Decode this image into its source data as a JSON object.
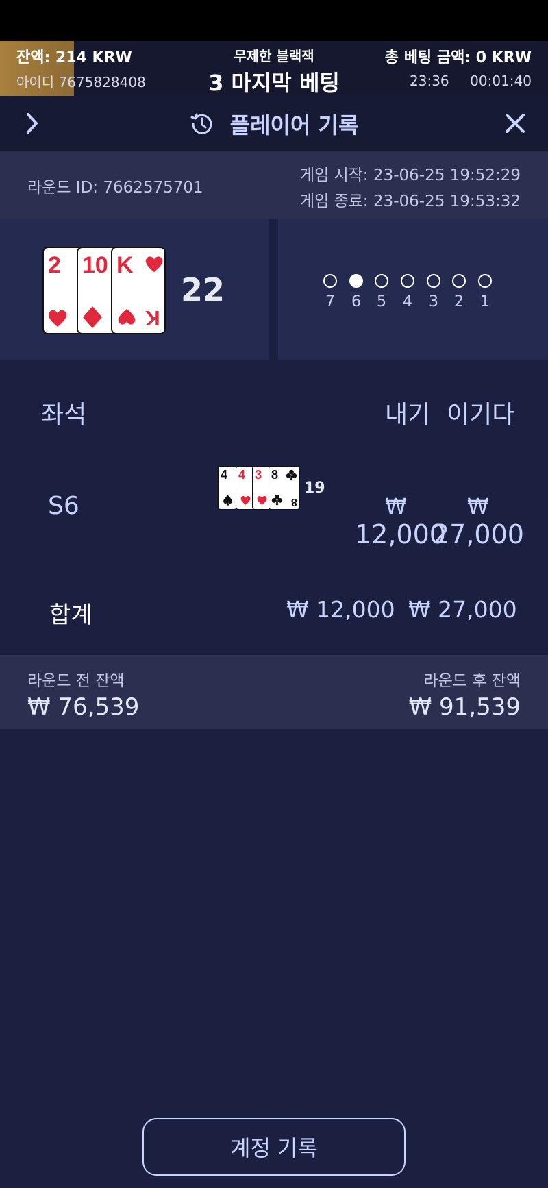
{
  "topbar": {
    "balance": "잔액: 214 KRW",
    "user_id": "아이디 7675828408",
    "game_name": "무제한 블랙잭",
    "phase": "3 마지막 베팅",
    "total_bet": "총 베팅 금액: 0 KRW",
    "clock": "23:36",
    "timer": "00:01:40"
  },
  "header": {
    "title": "플레이어 기록",
    "back_icon": "chevron-right-icon",
    "history_icon": "history-icon",
    "close_icon": "close-icon"
  },
  "round": {
    "round_id": "라운드 ID: 7662575701",
    "start": "게임 시작: 23-06-25 19:52:29",
    "end": "게임 종료: 23-06-25 19:53:32"
  },
  "dealer": {
    "cards": [
      {
        "rank": "2",
        "suit": "heart"
      },
      {
        "rank": "10",
        "suit": "diamond"
      },
      {
        "rank": "K",
        "suit": "heart"
      }
    ],
    "score": "22"
  },
  "seats": {
    "numbers": [
      "7",
      "6",
      "5",
      "4",
      "3",
      "2",
      "1"
    ],
    "active_seat": "6"
  },
  "table_headers": {
    "seat": "좌석",
    "bet": "내기",
    "win": "이기다"
  },
  "seat_row": {
    "seat": "S6",
    "cards": [
      {
        "rank": "4",
        "suit": "spade"
      },
      {
        "rank": "4",
        "suit": "heart"
      },
      {
        "rank": "3",
        "suit": "heart"
      },
      {
        "rank": "8",
        "suit": "club"
      }
    ],
    "score": "19",
    "currency": "₩",
    "bet": "12,000",
    "win": "27,000"
  },
  "totals": {
    "label": "합계",
    "bet": "₩ 12,000",
    "win": "₩ 27,000"
  },
  "balances": {
    "before_label": "라운드 전 잔액",
    "before_value": "₩ 76,539",
    "after_label": "라운드 후 잔액",
    "after_value": "₩ 91,539"
  },
  "account_button": "계정 기록",
  "colors": {
    "background": "#1c2040",
    "panel": "#252b50",
    "accent_text": "#c9d3ff",
    "gold": "#a8803e",
    "card_red": "#e0293d"
  }
}
